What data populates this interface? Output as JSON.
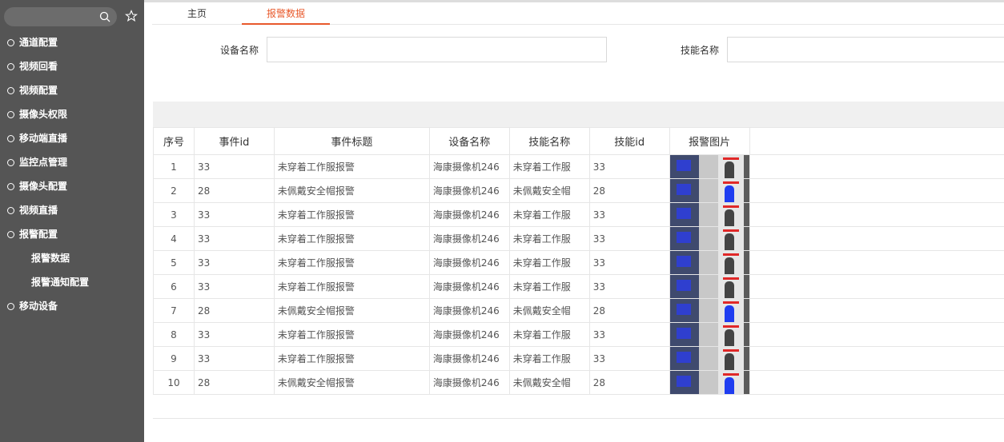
{
  "sidebar": {
    "search": {
      "placeholder": ""
    },
    "items": [
      {
        "label": "通道配置"
      },
      {
        "label": "视频回看"
      },
      {
        "label": "视频配置"
      },
      {
        "label": "摄像头权限"
      },
      {
        "label": "移动端直播"
      },
      {
        "label": "监控点管理"
      },
      {
        "label": "摄像头配置"
      },
      {
        "label": "视频直播"
      },
      {
        "label": "报警配置"
      },
      {
        "label": "报警数据"
      },
      {
        "label": "报警通知配置"
      },
      {
        "label": "移动设备"
      }
    ]
  },
  "tabs": [
    {
      "label": "主页"
    },
    {
      "label": "报警数据"
    }
  ],
  "filters": {
    "device_label": "设备名称",
    "device_value": "",
    "skill_label": "技能名称",
    "skill_value": ""
  },
  "table": {
    "headers": [
      "序号",
      "事件id",
      "事件标题",
      "设备名称",
      "技能名称",
      "技能id",
      "报警图片"
    ],
    "rows": [
      [
        "1",
        "33",
        "未穿着工作服报警",
        "海康摄像机246",
        "未穿着工作服",
        "33"
      ],
      [
        "2",
        "28",
        "未佩戴安全帽报警",
        "海康摄像机246",
        "未佩戴安全帽",
        "28"
      ],
      [
        "3",
        "33",
        "未穿着工作服报警",
        "海康摄像机246",
        "未穿着工作服",
        "33"
      ],
      [
        "4",
        "33",
        "未穿着工作服报警",
        "海康摄像机246",
        "未穿着工作服",
        "33"
      ],
      [
        "5",
        "33",
        "未穿着工作服报警",
        "海康摄像机246",
        "未穿着工作服",
        "33"
      ],
      [
        "6",
        "33",
        "未穿着工作服报警",
        "海康摄像机246",
        "未穿着工作服",
        "33"
      ],
      [
        "7",
        "28",
        "未佩戴安全帽报警",
        "海康摄像机246",
        "未佩戴安全帽",
        "28"
      ],
      [
        "8",
        "33",
        "未穿着工作服报警",
        "海康摄像机246",
        "未穿着工作服",
        "33"
      ],
      [
        "9",
        "33",
        "未穿着工作服报警",
        "海康摄像机246",
        "未穿着工作服",
        "33"
      ],
      [
        "10",
        "28",
        "未佩戴安全帽报警",
        "海康摄像机246",
        "未佩戴安全帽",
        "28"
      ]
    ]
  },
  "colors": {
    "sidebar_bg": "#555555",
    "accent": "#e8592b"
  }
}
